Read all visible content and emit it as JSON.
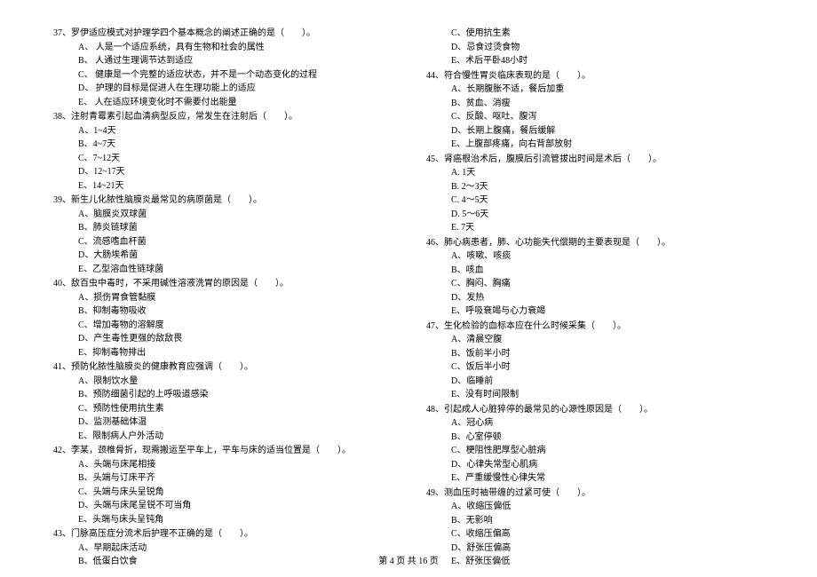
{
  "left": {
    "q37": {
      "stem": "37、罗伊适应模式对护理学四个基本概念的阐述正确的是（　　）。",
      "a": "A、 人是一个适应系统，具有生物和社会的属性",
      "b": "B、 人通过生理调节达到适应",
      "c": "C、 健康是一个完整的适应状态，并不是一个动态变化的过程",
      "d": "D、 护理的目标是促进人在生理功能上的适应",
      "e": "E、 人在适应环境变化时不需要付出能量"
    },
    "q38": {
      "stem": "38、注射青霉素引起血清病型反应，常发生在注射后（　　）。",
      "a": "A、1~4天",
      "b": "B、4~7天",
      "c": "C、7~12天",
      "d": "D、12~17天",
      "e": "E、14~21天"
    },
    "q39": {
      "stem": "39、新生儿化脓性脑膜炎最常见的病原菌是（　　）。",
      "a": "A、脑膜炎双球菌",
      "b": "B、肺炎链球菌",
      "c": "C、流感嗜血杆菌",
      "d": "D、大肠埃希菌",
      "e": "E、乙型溶血性链球菌"
    },
    "q40": {
      "stem": "40、敌百虫中毒时，不采用碱性溶液洗胃的原因是（　　）。",
      "a": "A、损伤胃食管黏膜",
      "b": "B、抑制毒物吸收",
      "c": "C、增加毒物的溶解度",
      "d": "D、产生毒性更强的敌敌畏",
      "e": "E、抑制毒物排出"
    },
    "q41": {
      "stem": "41、预防化脓性脑膜炎的健康教育应强调（　　）。",
      "a": "A、限制饮水量",
      "b": "B、预防细菌引起的上呼吸道感染",
      "c": "C、预防性使用抗生素",
      "d": "D、监测基础体温",
      "e": "E、限制病人户外活动"
    },
    "q42": {
      "stem": "42、李某，颈椎骨折，现需搬运至平车上，平车与床的适当位置是（　　）。",
      "a": "A、头端与床尾相接",
      "b": "B、头端与订床平齐",
      "c": "C、头端与床头呈锐角",
      "d": "D、头端与床尾呈锐不可当角",
      "e": "E、头端与床头呈钝角"
    },
    "q43": {
      "stem": "43、门脉高压症分流术后护理不正确的是（　　）。",
      "a": "A、早期起床活动",
      "b": "B、低蛋白饮食"
    }
  },
  "right": {
    "q43c": {
      "c": "C、使用抗生素",
      "d": "D、忌食过烫食物",
      "e": "E、术后平卧48小时"
    },
    "q44": {
      "stem": "44、符合慢性胃炎临床表现的是（　　）。",
      "a": "A、长期腹胀不适，餐后加重",
      "b": "B、贫血、消瘦",
      "c": "C、反酸、呕吐、腹泻",
      "d": "D、长期上腹痛，餐后缓解",
      "e": "E、上腹部疼痛，向右背部放射"
    },
    "q45": {
      "stem": "45、肾癌根治术后，腹膜后引流管拔出时间是术后（　　）。",
      "a": "A. 1天",
      "b": "B. 2～3天",
      "c": "C. 4～5天",
      "d": "D. 5～6天",
      "e": "E. 7天"
    },
    "q46": {
      "stem": "46、肺心病患者，肺、心功能失代偿期的主要表现是（　　）。",
      "a": "A、咳嗽、咳痰",
      "b": "B、咳血",
      "c": "C、胸闷、胸痛",
      "d": "D、发热",
      "e": "E、呼吸衰竭与心力衰竭"
    },
    "q47": {
      "stem": "47、生化检验的血标本应在什么时候采集（　　）。",
      "a": "A、清晨空腹",
      "b": "B、饭前半小时",
      "c": "C、饭后半小时",
      "d": "D、临睡前",
      "e": "E、没有时间限制"
    },
    "q48": {
      "stem": "48、引起成人心脏猝停的最常见的心源性原因是（　　）。",
      "a": "A、冠心病",
      "b": "B、心室停顿",
      "c": "C、梗阻性肥厚型心脏病",
      "d": "D、心律失常型心肌病",
      "e": "E、严重缓慢性心律失常"
    },
    "q49": {
      "stem": "49、测血压时袖带缠的过紧可使（　　）。",
      "a": "A、收缩压偏低",
      "b": "B、无影响",
      "c": "C、收缩压偏高",
      "d": "D、舒张压偏高",
      "e": "E、舒张压偏低"
    }
  },
  "footer": "第 4 页 共 16 页"
}
